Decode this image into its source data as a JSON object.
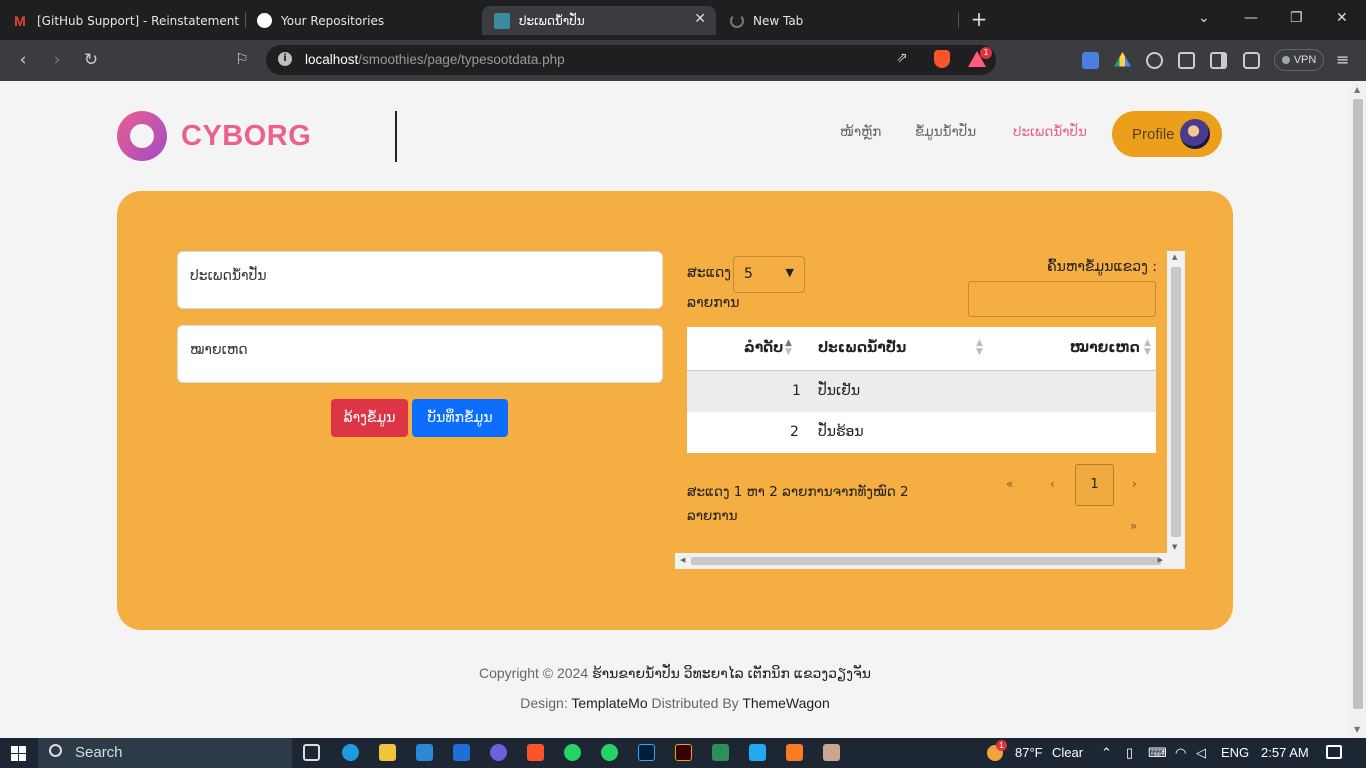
{
  "browser": {
    "tabs": [
      {
        "title": "[GitHub Support] - Reinstatement Re",
        "icon": "gmail-icon"
      },
      {
        "title": "Your Repositories",
        "icon": "github-icon"
      },
      {
        "title": "ປະເພດນ້ຳປັ່ນ",
        "icon": "site-favicon"
      },
      {
        "title": "New Tab",
        "icon": "loading-icon"
      }
    ],
    "url_host": "localhost",
    "url_path": "/smoothies/page/typesootdata.php",
    "notification_count": "1",
    "vpn_label": "VPN"
  },
  "header": {
    "logo_text": "CYBORG",
    "nav": [
      "ໜ້າຫຼັກ",
      "ຂໍ້ມູນນ້ຳປັ່ນ",
      "ປະເພດນ້ຳປັ່ນ"
    ],
    "active_nav": 2,
    "profile_label": "Profile"
  },
  "form": {
    "type_placeholder": "ປະເພດນ້ຳປັ່ນ",
    "note_placeholder": "ໝາຍເຫດ",
    "clear_label": "ລ້າງຂໍ້ມູນ",
    "save_label": "ບັນທຶກຂໍ້ມູນ"
  },
  "datatable": {
    "show_label": "ສະແດງ",
    "page_size": "5",
    "entries_label": "ລາຍການ",
    "search_label": "ຄົ້ນຫາຂໍ້ມູນແຂວງ :",
    "columns": [
      "ລຳດັບ",
      "ປະເພດນ້ຳປັ່ນ",
      "ໝາຍເຫດ"
    ],
    "rows": [
      {
        "no": "1",
        "type": "ປັ່ນເຢັນ",
        "note": ""
      },
      {
        "no": "2",
        "type": "ປັ່ນຮ້ອນ",
        "note": ""
      }
    ],
    "info_line1": "ສະແດງ 1 ຫາ 2 ລາຍການຈາກທັງໝົດ 2",
    "info_line2": "ລາຍການ",
    "pager": {
      "first": "«",
      "prev": "‹",
      "current": "1",
      "next": "›",
      "last": "»"
    }
  },
  "footer": {
    "copyright_prefix": "Copyright © 2024",
    "copyright_text": "ຮ້ານຂາຍນ້ຳປັ່ນ ວິທະຍາໄລ ເຕັກນິກ ແຂວງວຽງຈັນ",
    "design_label": "Design:",
    "design_by": "TemplateMo",
    "distributed_label": "Distributed By",
    "distributed_by": "ThemeWagon"
  },
  "taskbar": {
    "search_label": "Search",
    "temperature": "87°F",
    "weather": "Clear",
    "language": "ENG",
    "time": "2:57 AM",
    "weather_badge": "1"
  },
  "colors": {
    "accent": "#ec6090",
    "panel": "#f4ae41",
    "profile": "#ec9f1b",
    "danger": "#dc3545",
    "primary": "#0d6efd"
  }
}
